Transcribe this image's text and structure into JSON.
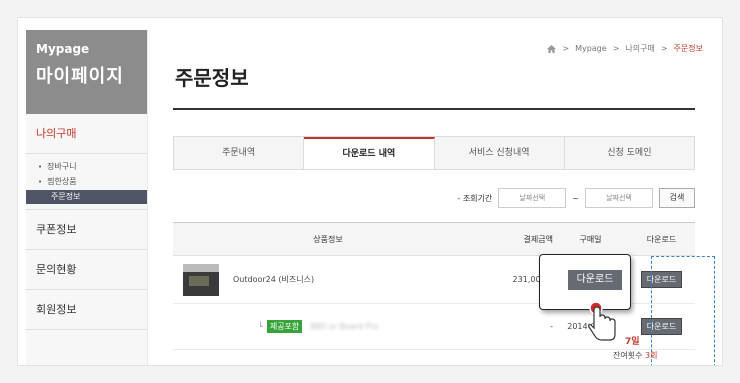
{
  "sidebar": {
    "brand_en": "Mypage",
    "brand_kr": "마이페이지",
    "section_active": "나의구매",
    "sub_items": [
      "장바구니",
      "찜한상품",
      "주문정보"
    ],
    "sections": [
      "쿠폰정보",
      "문의현황",
      "회원정보"
    ]
  },
  "breadcrumb": {
    "items": [
      "Mypage",
      "나의구매",
      "주문정보"
    ],
    "separator": ">"
  },
  "page_title": "주문정보",
  "tabs": [
    "주문내역",
    "다운로드 내역",
    "서비스 신청내역",
    "신청 도메인"
  ],
  "period": {
    "label": "- 조회기간",
    "start_placeholder": "날짜선택",
    "tilde": "~",
    "end_placeholder": "날짜선택",
    "search_label": "검색"
  },
  "table": {
    "headers": [
      "상품정보",
      "결제금액",
      "구매일",
      "다운로드"
    ],
    "rows": [
      {
        "product": "Outdoor24 (비즈니스)",
        "price": "231,000원",
        "date": "",
        "download": "다운로드"
      },
      {
        "prefix": "└",
        "badge": "제공포함",
        "product": "BBS or Board Pro",
        "price": "-",
        "date": "2014-07-09",
        "download": "다운로드"
      }
    ],
    "days_left": "7일",
    "remain_label": "잔여횟수",
    "remain_count": "3회"
  },
  "callout": {
    "label": "다운로드"
  },
  "colors": {
    "accent": "#c0392b",
    "dark_button": "#666a72",
    "dashed": "#3a7fc6",
    "badge": "#37a33a"
  }
}
